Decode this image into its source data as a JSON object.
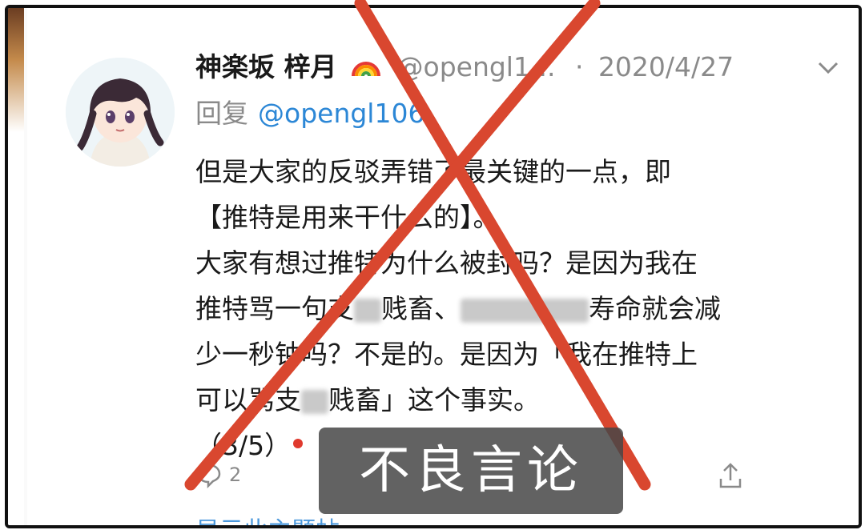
{
  "tweet": {
    "display_name": "神楽坂 梓月",
    "handle": "@opengl1...",
    "separator": "·",
    "date": "2020/4/27",
    "reply_prefix": "回复",
    "reply_to": "@opengl106",
    "body_lines": [
      "但是大家的反驳弄错了最关键的一点，即",
      "【推特是用来干什么的】。",
      "大家有想过推特为什么被封吗？是因为我在",
      "推特骂一句支",
      "贱畜、",
      "寿命就会减",
      "少一秒钟吗？不是的。是因为「我在推特上",
      "可以骂支",
      "贱畜」这个事实。",
      "（3/5）"
    ],
    "reply_count": "2",
    "show_thread": "显示此主题帖"
  },
  "overlay": {
    "caption": "不良言论",
    "cross_color": "#d9472f"
  },
  "icons": {
    "caret": "chevron-down-icon",
    "reply": "comment-icon",
    "share": "share-icon",
    "rainbow": "rainbow-emoji"
  }
}
